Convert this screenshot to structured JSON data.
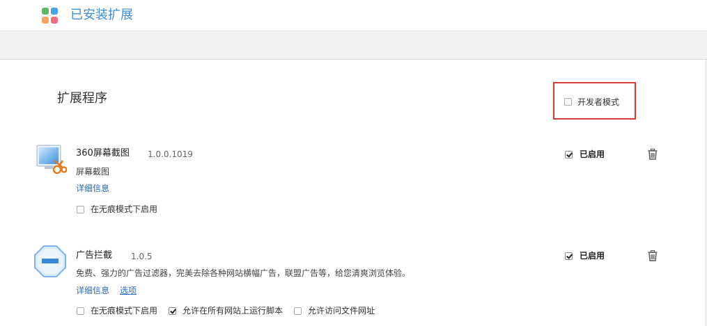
{
  "header": {
    "title": "已安装扩展"
  },
  "section": {
    "title": "扩展程序"
  },
  "developer_mode": {
    "label": "开发者模式",
    "checked": false
  },
  "extensions": [
    {
      "name": "360屏幕截图",
      "version": "1.0.0.1019",
      "description": "屏幕截图",
      "details_link": "详细信息",
      "enabled_label": "已启用",
      "enabled": true,
      "incognito_label": "在无痕模式下启用",
      "incognito": false,
      "icon": "screenshot-scissors-icon"
    },
    {
      "name": "广告拦截",
      "version": "1.0.5",
      "description": "免费、强力的广告过滤器，完美去除各种网站横幅广告，联盟广告等，给您清爽浏览体验。",
      "details_link": "详细信息",
      "options_link": "选项",
      "enabled_label": "已启用",
      "enabled": true,
      "incognito_label": "在无痕模式下启用",
      "incognito": false,
      "all_sites_label": "允许在所有网站上运行脚本",
      "all_sites": true,
      "file_urls_label": "允许访问文件网址",
      "file_urls": false,
      "icon": "stop-sign-icon"
    }
  ],
  "colors": {
    "accent": "#3f8fd6",
    "link": "#2a6bbf",
    "highlight_border": "#d23a3a"
  }
}
